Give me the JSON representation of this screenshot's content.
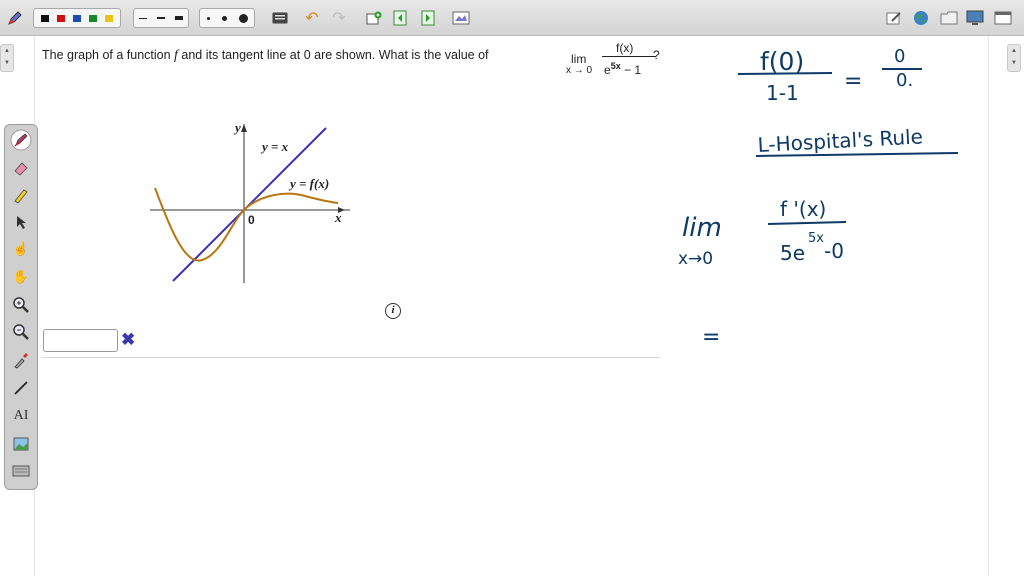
{
  "toolbar": {
    "pen_icon": "pen-icon",
    "colors": [
      "#111111",
      "#d01010",
      "#1a4fb0",
      "#168a2a",
      "#e6c419"
    ],
    "undo_icon": "undo-icon",
    "redo_icon": "redo-icon"
  },
  "question": {
    "prefix": "The graph of a function ",
    "f": "f",
    "middle": " and its tangent line at 0 are shown. What is the value of ",
    "lim": "lim",
    "lim_sub": "x → 0",
    "numerator": "f(x)",
    "denominator_base": "e",
    "denominator_exp": "5x",
    "denominator_tail": " − 1",
    "suffix": "?"
  },
  "graph": {
    "y_axis_label": "y",
    "x_axis_label": "x",
    "origin_label": "0",
    "tangent_label": "y = x",
    "curve_label": "y = f(x)",
    "tangent_color": "#3a2fc0",
    "curve_color": "#b7770f"
  },
  "answer": {
    "value": "",
    "mark": "✖"
  },
  "notes": {
    "frac1_num": "f(0)",
    "frac1_den": "1-1",
    "equals1": "=",
    "frac2_num": "0",
    "frac2_den": "0.",
    "rule": "L-Hospital's Rule",
    "lim": "lim",
    "lim_sub": "x→0",
    "frac3_num": "f '(x)",
    "frac3_den_base": "5e",
    "frac3_den_exp": "5x",
    "frac3_den_tail": "-0",
    "equals2": "="
  }
}
